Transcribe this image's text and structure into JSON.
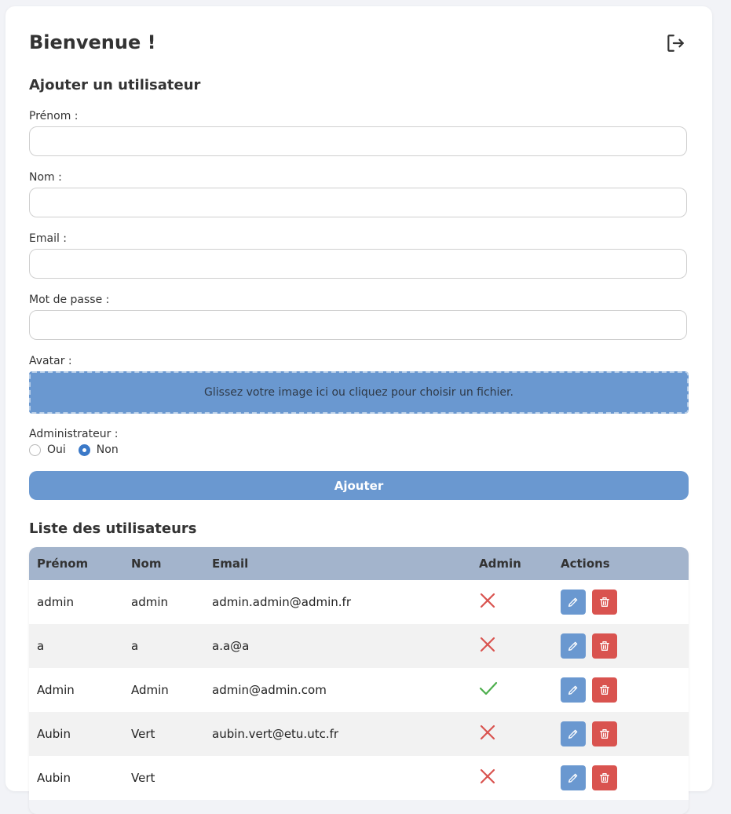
{
  "header": {
    "title": "Bienvenue !",
    "logout_icon": "logout-icon"
  },
  "form": {
    "title": "Ajouter un utilisateur",
    "fields": {
      "firstname": {
        "label": "Prénom :",
        "value": ""
      },
      "lastname": {
        "label": "Nom :",
        "value": ""
      },
      "email": {
        "label": "Email :",
        "value": ""
      },
      "password": {
        "label": "Mot de passe :",
        "value": ""
      }
    },
    "avatar": {
      "label": "Avatar :",
      "dropzone_text": "Glissez votre image ici ou cliquez pour choisir un fichier."
    },
    "admin": {
      "label": "Administrateur :",
      "options": [
        "Oui",
        "Non"
      ],
      "selected": "Non"
    },
    "submit_label": "Ajouter"
  },
  "users": {
    "title": "Liste des utilisateurs",
    "columns": [
      "Prénom",
      "Nom",
      "Email",
      "Admin",
      "Actions"
    ],
    "rows": [
      {
        "firstname": "admin",
        "lastname": "admin",
        "email": "admin.admin@admin.fr",
        "admin": false
      },
      {
        "firstname": "a",
        "lastname": "a",
        "email": "a.a@a",
        "admin": false
      },
      {
        "firstname": "Admin",
        "lastname": "Admin",
        "email": "admin@admin.com",
        "admin": true
      },
      {
        "firstname": "Aubin",
        "lastname": "Vert",
        "email": "aubin.vert@etu.utc.fr",
        "admin": false
      },
      {
        "firstname": "Aubin",
        "lastname": "Vert",
        "email": "",
        "admin": false
      }
    ]
  },
  "colors": {
    "accent": "#6a98d0",
    "danger": "#d9534f",
    "table_header": "#a3b4cc",
    "admin_yes": "#4cae4c",
    "admin_no": "#d9534f"
  }
}
